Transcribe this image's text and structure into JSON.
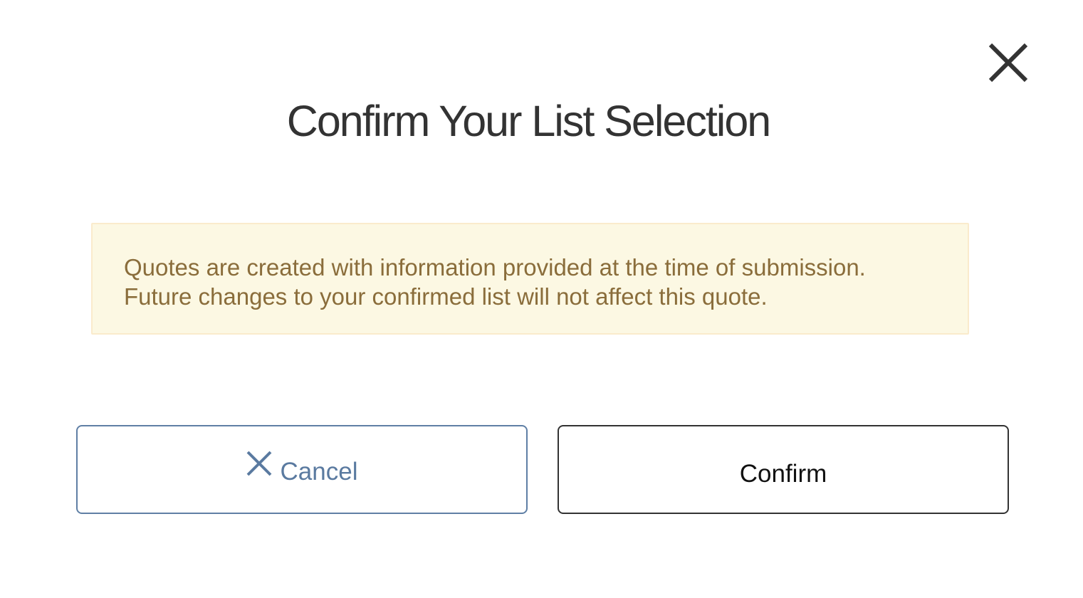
{
  "modal": {
    "title": "Confirm Your List Selection",
    "close_icon": "close-icon",
    "alert": {
      "line1": "Quotes are created with information provided at the time of submission.",
      "line2": "Future changes to your confirmed list will not affect this quote.",
      "background_color": "#fcf8e3",
      "text_color": "#8a6d3b"
    },
    "buttons": {
      "cancel_label": "Cancel",
      "cancel_icon": "close-icon",
      "confirm_label": "Confirm"
    }
  }
}
